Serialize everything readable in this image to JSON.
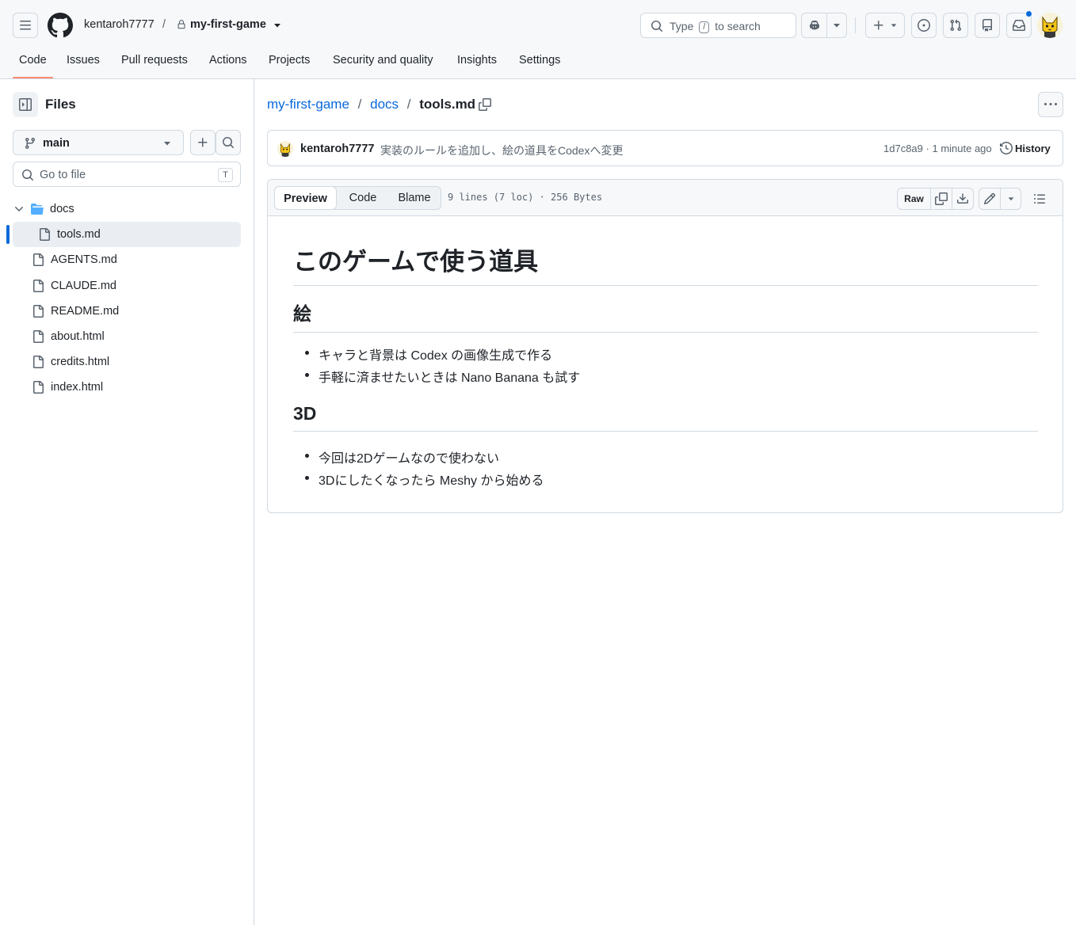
{
  "header": {
    "owner": "kentaroh7777",
    "separator": "/",
    "repo": "my-first-game",
    "search": {
      "prefix": "Type",
      "key": "/",
      "suffix": "to search"
    }
  },
  "tabs": [
    {
      "label": "Code",
      "selected": true
    },
    {
      "label": "Issues"
    },
    {
      "label": "Pull requests"
    },
    {
      "label": "Actions"
    },
    {
      "label": "Projects"
    },
    {
      "label": "Security and quality"
    },
    {
      "label": "Insights"
    },
    {
      "label": "Settings"
    }
  ],
  "sidebar": {
    "title": "Files",
    "branch": "main",
    "goto_placeholder": "Go to file",
    "goto_shortcut": "T",
    "tree": [
      {
        "type": "folder",
        "name": "docs",
        "expanded": true
      },
      {
        "type": "file",
        "name": "tools.md",
        "selected": true
      },
      {
        "type": "file",
        "name": "AGENTS.md"
      },
      {
        "type": "file",
        "name": "CLAUDE.md"
      },
      {
        "type": "file",
        "name": "README.md"
      },
      {
        "type": "file",
        "name": "about.html"
      },
      {
        "type": "file",
        "name": "credits.html"
      },
      {
        "type": "file",
        "name": "index.html"
      }
    ]
  },
  "path": {
    "repo": "my-first-game",
    "folder": "docs",
    "file": "tools.md",
    "sep": "/"
  },
  "commit": {
    "author": "kentaroh7777",
    "message": "実装のルールを追加し、絵の道具をCodexへ変更",
    "hash": "1d7c8a9",
    "time": "1 minute ago",
    "meta_sep": "·",
    "history_label": "History"
  },
  "file_view": {
    "tabs": [
      "Preview",
      "Code",
      "Blame"
    ],
    "active_tab": "Preview",
    "stats": "9 lines (7 loc) · 256 Bytes",
    "raw_label": "Raw"
  },
  "markdown": {
    "h1": "このゲームで使う道具",
    "sections": [
      {
        "heading": "絵",
        "items": [
          "キャラと背景は Codex の画像生成で作る",
          "手軽に済ませたいときは Nano Banana も試す"
        ]
      },
      {
        "heading": "3D",
        "items": [
          "今回は2Dゲームなので使わない",
          "3Dにしたくなったら Meshy から始める"
        ]
      }
    ]
  },
  "colors": {
    "accent": "#0969da",
    "tab_underline": "#fd8c73",
    "folder": "#54aeff",
    "border": "#d1d9e0"
  }
}
